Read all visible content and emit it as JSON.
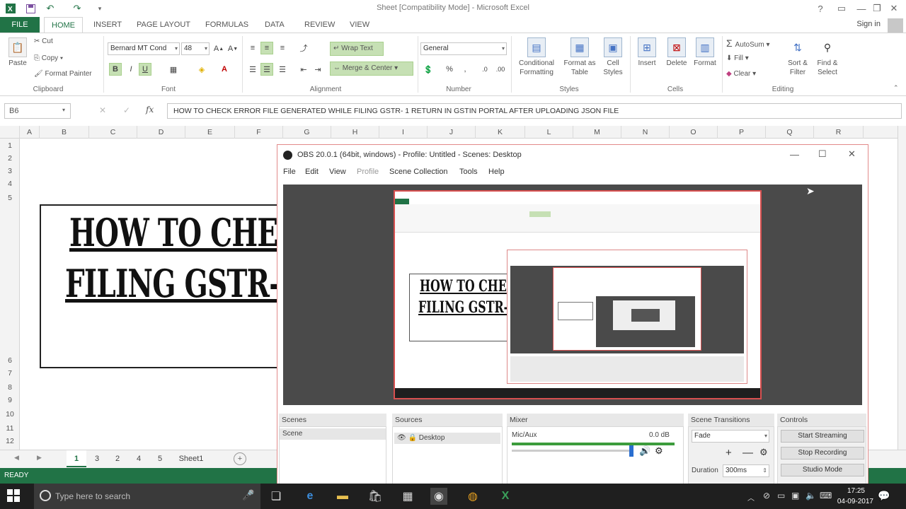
{
  "excel": {
    "title": "Sheet  [Compatibility Mode] - Microsoft Excel",
    "signin": "Sign in",
    "tabs": [
      "FILE",
      "HOME",
      "INSERT",
      "PAGE LAYOUT",
      "FORMULAS",
      "DATA",
      "REVIEW",
      "VIEW"
    ],
    "clipboard": {
      "paste": "Paste",
      "cut": "Cut",
      "copy": "Copy",
      "format_painter": "Format Painter",
      "label": "Clipboard"
    },
    "font": {
      "name": "Bernard MT Cond",
      "size": "48",
      "label": "Font"
    },
    "alignment": {
      "wrap": "Wrap Text",
      "merge": "Merge & Center",
      "label": "Alignment"
    },
    "number": {
      "format": "General",
      "label": "Number"
    },
    "styles": {
      "conditional": "Conditional",
      "conditional2": "Formatting",
      "format_table": "Format as",
      "format_table2": "Table",
      "cell_styles": "Cell",
      "cell_styles2": "Styles",
      "label": "Styles"
    },
    "cells": {
      "insert": "Insert",
      "delete": "Delete",
      "format": "Format",
      "label": "Cells"
    },
    "editing": {
      "autosum": "AutoSum",
      "fill": "Fill",
      "clear": "Clear",
      "sort": "Sort &",
      "sort2": "Filter",
      "find": "Find &",
      "find2": "Select",
      "label": "Editing"
    },
    "name_box": "B6",
    "formula": "HOW TO CHECK ERROR FILE GENERATED WHILE FILING GSTR- 1 RETURN IN GSTIN PORTAL AFTER UPLOADING JSON FILE",
    "columns": [
      "A",
      "B",
      "C",
      "D",
      "E",
      "F",
      "G",
      "H",
      "I",
      "J",
      "K",
      "L",
      "M",
      "N",
      "O",
      "P",
      "Q",
      "R"
    ],
    "rows": [
      "1",
      "2",
      "3",
      "4",
      "5",
      "6",
      "7",
      "8",
      "9",
      "10",
      "11",
      "12"
    ],
    "title_line1": "HOW TO CHEC",
    "title_line2": "FILING GSTR-",
    "sheet_tabs": [
      "1",
      "3",
      "2",
      "4",
      "5",
      "Sheet1"
    ],
    "status": "READY"
  },
  "obs": {
    "title": "OBS 20.0.1 (64bit, windows) - Profile: Untitled - Scenes: Desktop",
    "menu": [
      "File",
      "Edit",
      "View",
      "Profile",
      "Scene Collection",
      "Tools",
      "Help"
    ],
    "panels": {
      "scenes": "Scenes",
      "sources": "Sources",
      "mixer": "Mixer",
      "transitions": "Scene Transitions",
      "controls": "Controls"
    },
    "scene_item": "Scene",
    "source_item": "Desktop",
    "mixer_track": "Mic/Aux",
    "mixer_db": "0.0 dB",
    "transition": "Fade",
    "duration_label": "Duration",
    "duration_value": "300ms",
    "buttons": {
      "start_streaming": "Start Streaming",
      "stop_recording": "Stop Recording",
      "studio_mode": "Studio Mode"
    },
    "nested_title1": "HOW TO CHE",
    "nested_title2": "FILING GSTR-"
  },
  "taskbar": {
    "search_placeholder": "Type here to search",
    "time": "17:25",
    "date": "04-09-2017"
  },
  "colors": {
    "excel_green": "#217346",
    "obs_preview": "#4a4a4a",
    "taskbar": "#1f1f1f"
  }
}
